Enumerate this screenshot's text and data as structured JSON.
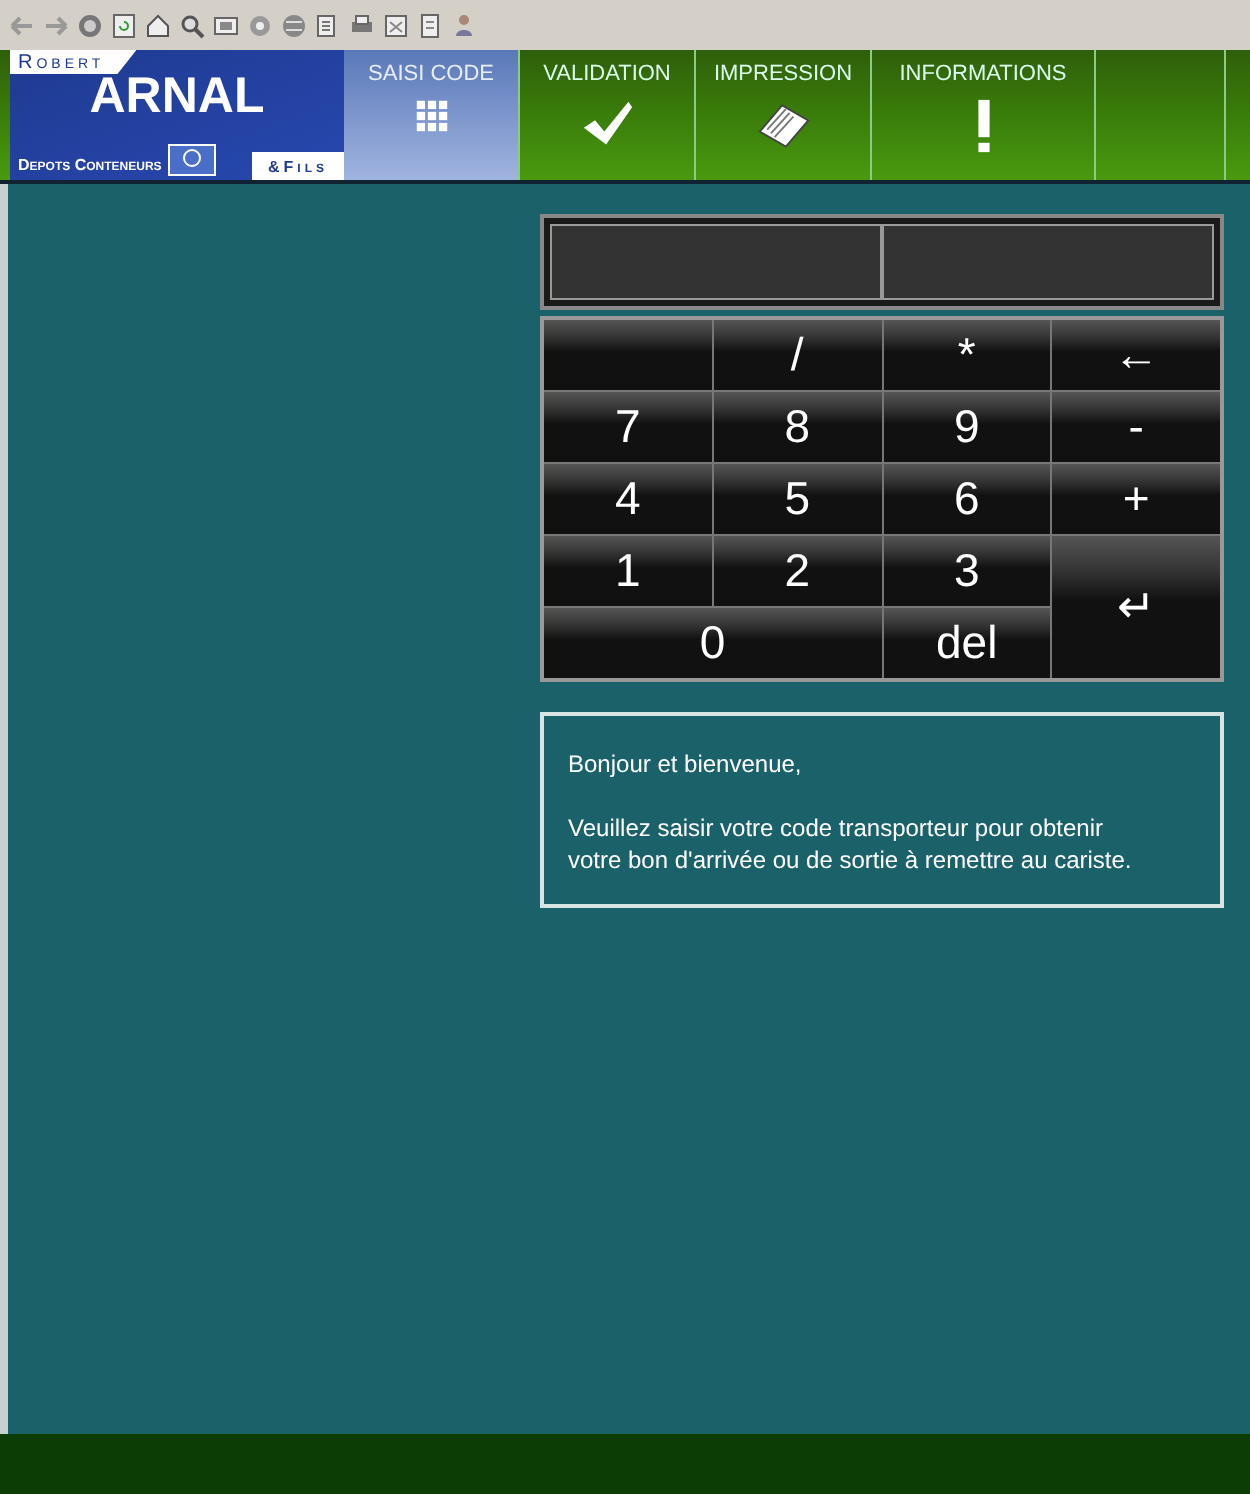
{
  "toolbar": {
    "icons": [
      {
        "kind": "back"
      },
      {
        "kind": "forward"
      },
      {
        "kind": "stop"
      },
      {
        "kind": "refresh"
      },
      {
        "kind": "home"
      },
      {
        "kind": "search"
      },
      {
        "kind": "favorites"
      },
      {
        "kind": "media"
      },
      {
        "kind": "history"
      },
      {
        "kind": "mail"
      },
      {
        "kind": "print"
      },
      {
        "kind": "edit"
      },
      {
        "kind": "page"
      },
      {
        "kind": "tool"
      }
    ]
  },
  "logo": {
    "top": "Robert",
    "name": "ARNAL",
    "subtitle": "Depots Conteneurs",
    "suffix": "&Fils"
  },
  "tabs": [
    {
      "label": "SAISI CODE",
      "kind": "grid",
      "selected": true
    },
    {
      "label": "VALIDATION",
      "kind": "check",
      "selected": false
    },
    {
      "label": "IMPRESSION",
      "kind": "notepad",
      "selected": false
    },
    {
      "label": "INFORMATIONS",
      "kind": "exclamation",
      "selected": false
    }
  ],
  "keypad": {
    "keys": [
      {
        "kind": "blank"
      },
      {
        "label": "/",
        "kind": "key"
      },
      {
        "label": "*",
        "kind": "key"
      },
      {
        "label": "←",
        "kind": "key"
      },
      {
        "label": "7",
        "kind": "key"
      },
      {
        "label": "8",
        "kind": "key"
      },
      {
        "label": "9",
        "kind": "key"
      },
      {
        "label": "-",
        "kind": "key"
      },
      {
        "label": "4",
        "kind": "key"
      },
      {
        "label": "5",
        "kind": "key"
      },
      {
        "label": "6",
        "kind": "key"
      },
      {
        "label": "+",
        "kind": "key"
      },
      {
        "label": "1",
        "kind": "key"
      },
      {
        "label": "2",
        "kind": "key"
      },
      {
        "label": "3",
        "kind": "key"
      },
      {
        "label": "↵",
        "kind": "tall"
      },
      {
        "label": "0",
        "kind": "wide"
      },
      {
        "label": "del",
        "kind": "key"
      }
    ]
  },
  "message": {
    "greeting": "Bonjour et bienvenue,",
    "body": "Veuillez saisir votre code transporteur pour obtenir votre bon d'arrivée ou de sortie à remettre au cariste."
  }
}
